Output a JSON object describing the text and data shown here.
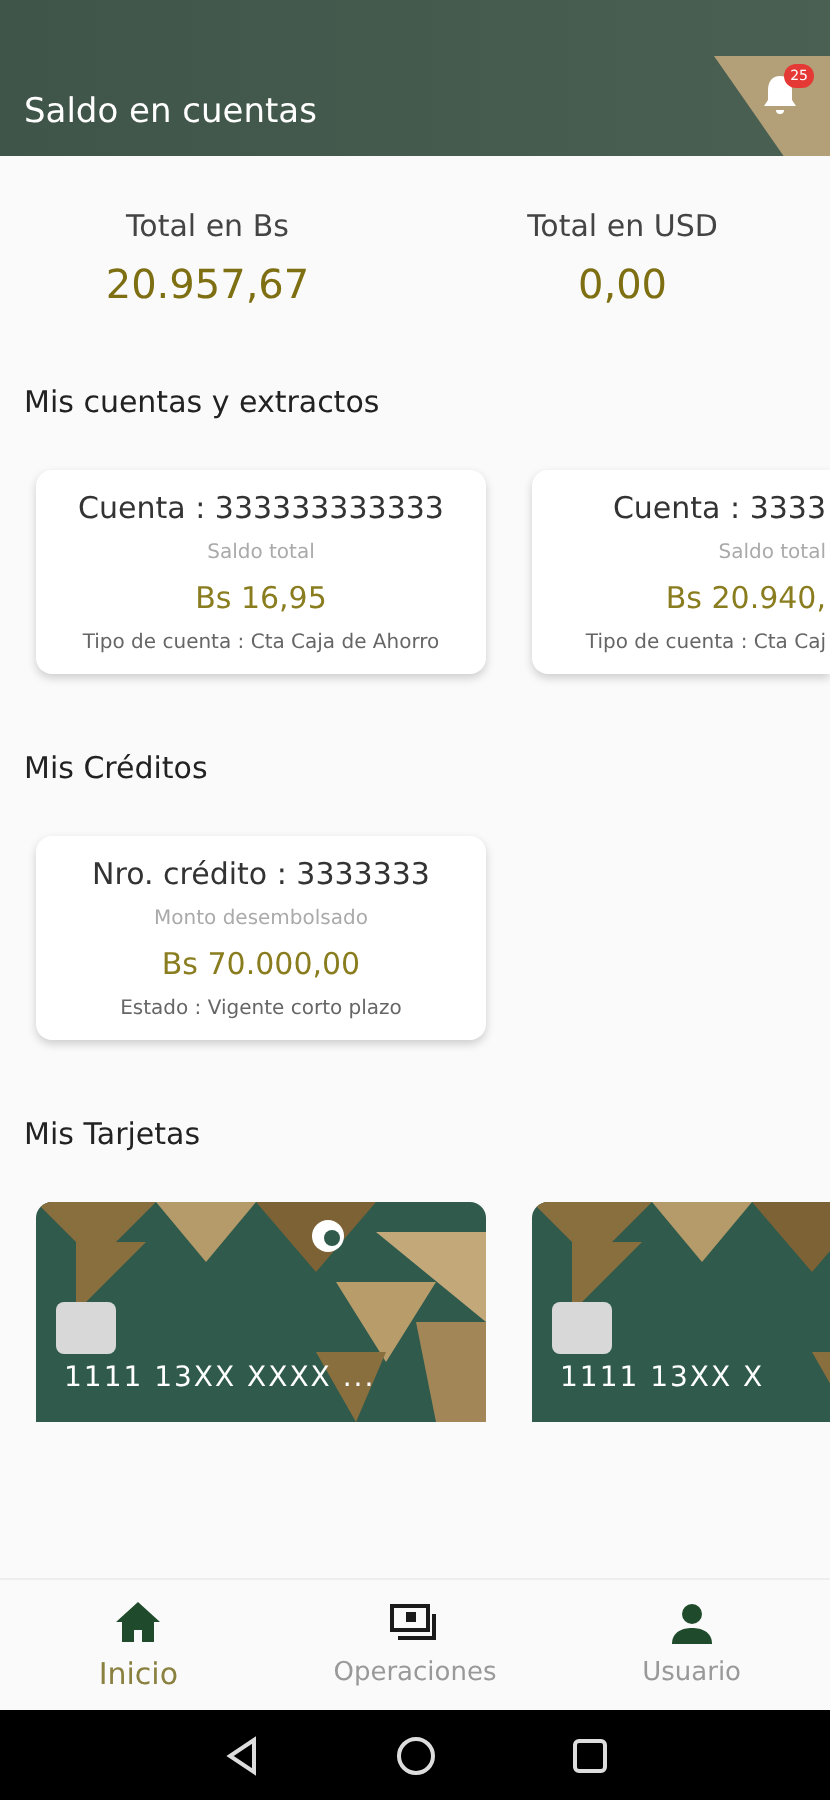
{
  "header": {
    "title": "Saldo en cuentas",
    "notification_count": "25"
  },
  "totals": [
    {
      "label": "Total en Bs",
      "amount": "20.957,67"
    },
    {
      "label": "Total en USD",
      "amount": "0,00"
    }
  ],
  "accounts": {
    "title": "Mis cuentas y extractos",
    "items": [
      {
        "number": "Cuenta : 333333333333",
        "balance_label": "Saldo total",
        "balance": "Bs 16,95",
        "type": "Tipo de cuenta : Cta Caja de Ahorro",
        "partial": false
      },
      {
        "number": "Cuenta : 3333",
        "balance_label": "Saldo total",
        "balance": "Bs 20.940,",
        "type": "Tipo de cuenta : Cta Caj",
        "partial": true
      }
    ]
  },
  "credits": {
    "title": "Mis Créditos",
    "items": [
      {
        "number": "Nro. crédito : 3333333",
        "amount_label": "Monto desembolsado",
        "amount": "Bs 70.000,00",
        "status": "Estado : Vigente corto plazo"
      }
    ]
  },
  "cards": {
    "title": "Mis Tarjetas",
    "items": [
      {
        "number": "1111 13XX XXXX ...",
        "partial": false
      },
      {
        "number": "1111 13XX X",
        "partial": true
      }
    ]
  },
  "nav": [
    {
      "kind": "home",
      "label": "Inicio",
      "selected": true
    },
    {
      "kind": "operations",
      "label": "Operaciones",
      "selected": false
    },
    {
      "kind": "user",
      "label": "Usuario",
      "selected": false
    }
  ]
}
